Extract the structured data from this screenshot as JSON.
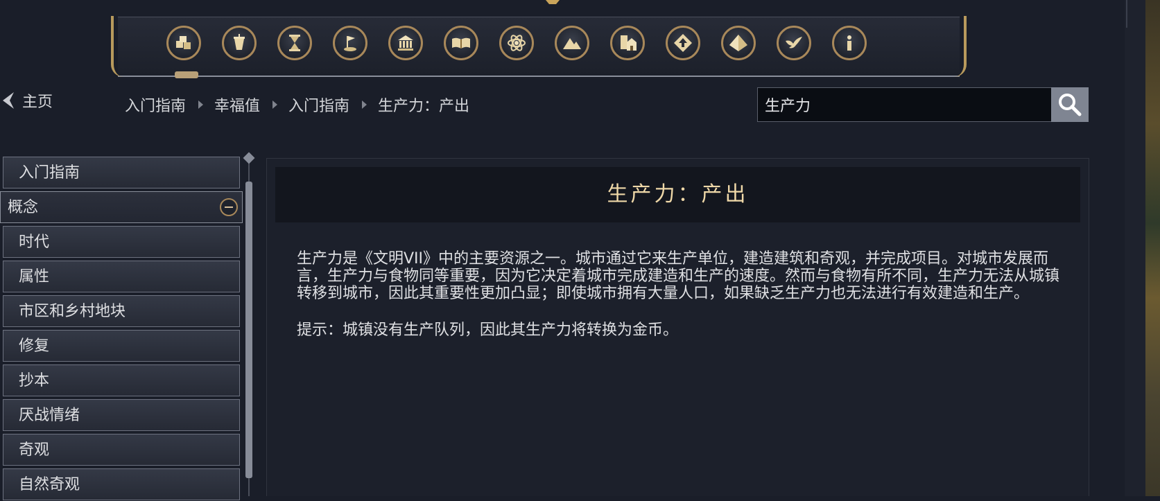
{
  "toolbar": {
    "icons": [
      "resources-icon",
      "happiness-icon",
      "ages-icon",
      "victory-icon",
      "government-icon",
      "civilopedia-icon",
      "science-icon",
      "terrain-icon",
      "districts-icon",
      "upgrade-icon",
      "wonders-icon",
      "diplomacy-icon",
      "info-icon"
    ]
  },
  "nav": {
    "home_label": "主页"
  },
  "breadcrumb": [
    "入门指南",
    "幸福值",
    "入门指南",
    "生产力：产出"
  ],
  "search": {
    "value": "生产力"
  },
  "sidebar": {
    "items": [
      "入门指南",
      "概念",
      "时代",
      "属性",
      "市区和乡村地块",
      "修复",
      "抄本",
      "厌战情绪",
      "奇观",
      "自然奇观"
    ]
  },
  "article": {
    "title": "生产力：产出",
    "paragraphs": [
      "生产力是《文明VII》中的主要资源之一。城市通过它来生产单位，建造建筑和奇观，并完成项目。对城市发展而言，生产力与食物同等重要，因为它决定着城市完成建造和生产的速度。然而与食物有所不同，生产力无法从城镇转移到城市，因此其重要性更加凸显；即使城市拥有大量人口，如果缺乏生产力也无法进行有效建造和生产。",
      "提示：城镇没有生产队列，因此其生产力将转换为金币。"
    ]
  },
  "colors": {
    "gold": "#c9a45a",
    "title": "#efd8a8",
    "background": "#1a1e29"
  }
}
